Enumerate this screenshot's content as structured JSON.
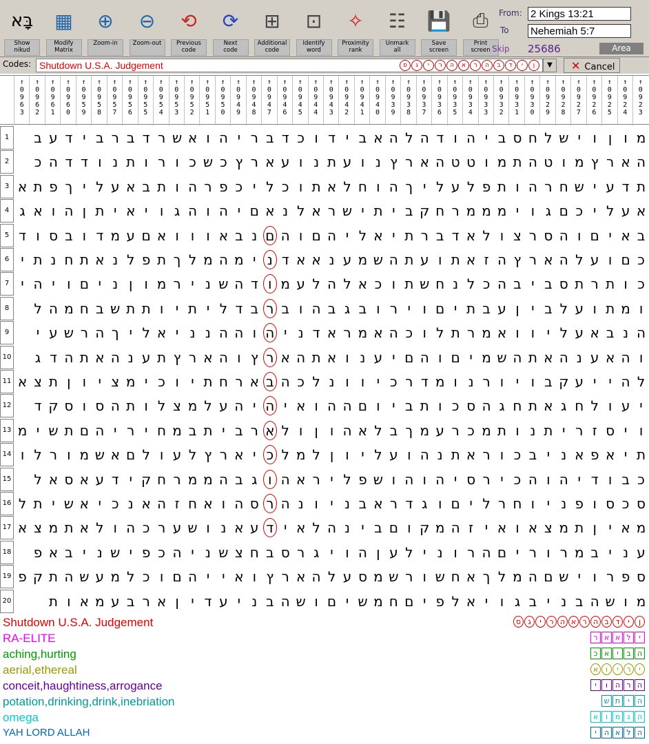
{
  "toolbar": [
    {
      "id": "show-nikud",
      "lines": [
        "Show",
        "nikud"
      ]
    },
    {
      "id": "modify-matrix",
      "lines": [
        "Modify",
        "Matrix"
      ]
    },
    {
      "id": "zoom-in",
      "lines": [
        "Zoom-in"
      ]
    },
    {
      "id": "zoom-out",
      "lines": [
        "Zoom-out"
      ]
    },
    {
      "id": "previous-code",
      "lines": [
        "Previous",
        "code"
      ]
    },
    {
      "id": "next-code",
      "lines": [
        "Next",
        "code"
      ]
    },
    {
      "id": "additional-code",
      "lines": [
        "Additional",
        "code"
      ]
    },
    {
      "id": "identify-word",
      "lines": [
        "Identify",
        "word"
      ]
    },
    {
      "id": "proximity-rank",
      "lines": [
        "Proximity",
        "rank"
      ]
    },
    {
      "id": "unmark-all",
      "lines": [
        "Unmark",
        "all"
      ]
    },
    {
      "id": "save-screen",
      "lines": [
        "Save",
        "screen"
      ]
    },
    {
      "id": "print-screen",
      "lines": [
        "Print",
        "screen"
      ]
    }
  ],
  "range": {
    "from_label": "From:",
    "from_value": "2 Kings 13:21",
    "to_label": "To",
    "to_value": "Nehemiah 5:7",
    "skip_label": "Skip",
    "skip_value": "25686",
    "area_label": "Area"
  },
  "codes": {
    "label": "Codes:",
    "value": "Shutdown U.S.A. Judgement",
    "sequence": "סגירהארהבדין",
    "cancel_label": "Cancel"
  },
  "skips": [
    "0963",
    "0962",
    "0961",
    "0960",
    "0959",
    "0958",
    "0957",
    "0956",
    "0955",
    "0954",
    "0953",
    "0952",
    "0951",
    "0950",
    "0949",
    "0948",
    "0947",
    "0946",
    "0945",
    "0944",
    "0943",
    "0942",
    "0941",
    "0940",
    "0939",
    "0938",
    "0937",
    "0936",
    "0935",
    "0934",
    "0933",
    "0932",
    "0931",
    "0930",
    "0929",
    "0928",
    "0927",
    "0926",
    "0925",
    "0924",
    "0923"
  ],
  "rows": [
    "מוןוישלחסביהודהלהאבידוכדבריהואשרדברבידעב",
    "הארץמוטהתמוטטהארץנועתנועארץכשכורותנודדהכ",
    "תדעישחרהותפלעליךהוחלאתוכליכפרהותבאעליךפתא",
    "אעליכםגוימממרחקביתישראלנאםיהוהגויאיתןהואגו",
    "באיםוהסרצולאדברתיאליהםוהםנבאווואםעמדובסודי",
    "כםועלהארץהזאתועתהשמענאאדנימהמלךתפלנאתחנתיל",
    "כותרתסביבהכלנחשתוכאלהלעמודהשנירמוןניםויהי",
    "ומתועלביןעבתיםוירובגבהוברבדליתיותתשבחמהל",
    "הנבאעליוואמרתלוכהאמראדניהוההנניאליךהרשעי",
    "והאענהאתהשמיםוהםיענואתהארץוהארץתענהאתהדג",
    "להייעקבויורנומדרכיוונלכהבארחתיוכימציוןתצא",
    "יעולחגאתחגהסכותביוםההואיהיהעלמצלותהסוסקד",
    "ויסזריתנותמכרעמךבלאהוןולארביתבמחיריהםתשימ",
    "תיאפאניבכוראתנהועליוןלמלכיארץלעולםאשמורלו",
    "כבודיהוהכירסיהוהושפליראהוגבהממרחקידעאסאל",
    "סכסופניוחרליםוגדראבניונהרסהואחזהאנכיאשיתל",
    "מאיןתמצאואיזהמקוםבינהלאידעאנושערכהולאתמצא",
    "עניבמרוריםהרוניל עןהויגרסבחצשניהכפישניבאפ",
    "ספרוישםהמלךאחשורשמסעלהארץואייהםוכלמעשהתקפ",
    "מושהבניבגויאלפיםחמשיםושהבניעדיןארבעמאות"
  ],
  "legend": [
    {
      "text": "Shutdown U.S.A. Judgement",
      "color": "#e00000",
      "seq": "סגירהארהבדין",
      "shape": "oval"
    },
    {
      "text": "RA-ELITE",
      "color": "#ee00ee",
      "seq": "ראאלי",
      "shape": "rect"
    },
    {
      "text": "aching,hurting",
      "color": "#009900",
      "seq": "כאיבה",
      "shape": "rect"
    },
    {
      "text": "aerial,ethereal",
      "color": "#999900",
      "seq": "אוירי",
      "shape": "oval"
    },
    {
      "text": "conceit,haughtiness,arrogance",
      "color": "#660099",
      "seq": "יוהרה",
      "shape": "rect"
    },
    {
      "text": "potation,drinking,drink,inebriation",
      "color": "#009999",
      "seq": "שתיה",
      "shape": "hex"
    },
    {
      "text": "omega",
      "color": "#00cccc",
      "seq": "אומגה",
      "shape": "rect"
    },
    {
      "text": "YAH LORD ALLAH",
      "color": "#0066aa",
      "seq": "יהאלה",
      "shape": "hex"
    }
  ]
}
